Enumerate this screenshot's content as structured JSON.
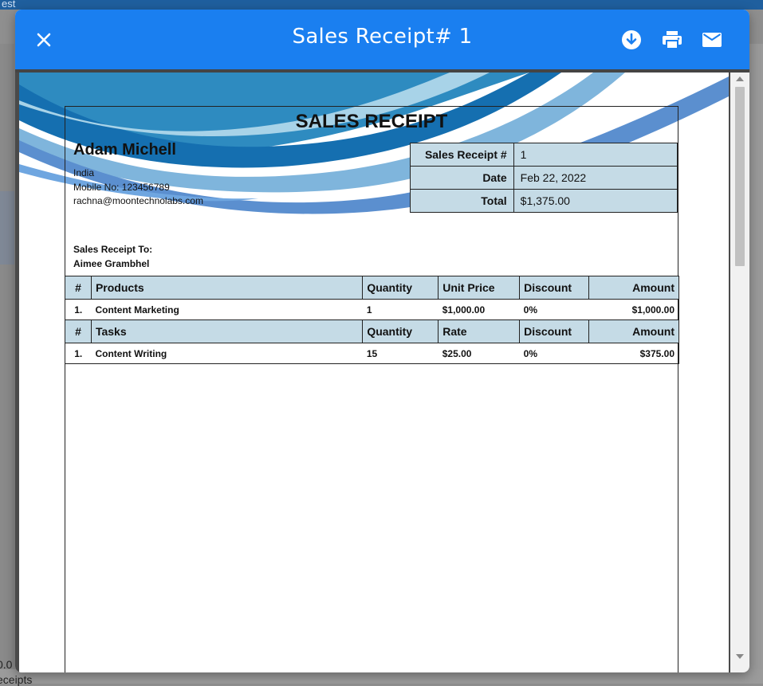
{
  "dialog": {
    "title": "Sales Receipt# 1"
  },
  "background": {
    "top_text": "est",
    "bottom_value": "0.0",
    "bottom_label": "eceipts"
  },
  "receipt": {
    "heading": "SALES RECEIPT",
    "company": {
      "name": "Adam Michell",
      "country": "India",
      "mobile": "Mobile No: 123456789",
      "email": "rachna@moontechnolabs.com"
    },
    "meta": [
      {
        "label": "Sales Receipt #",
        "value": "1"
      },
      {
        "label": "Date",
        "value": "Feb 22, 2022"
      },
      {
        "label": "Total",
        "value": "$1,375.00"
      }
    ],
    "bill_to_label": "Sales Receipt To:",
    "bill_to_name": "Aimee Grambhel",
    "products_header": {
      "num": "#",
      "name": "Products",
      "qty": "Quantity",
      "price": "Unit Price",
      "discount": "Discount",
      "amount": "Amount"
    },
    "products": [
      {
        "num": "1.",
        "name": "Content Marketing",
        "qty": "1",
        "price": "$1,000.00",
        "discount": "0%",
        "amount": "$1,000.00"
      }
    ],
    "tasks_header": {
      "num": "#",
      "name": "Tasks",
      "qty": "Quantity",
      "price": "Rate",
      "discount": "Discount",
      "amount": "Amount"
    },
    "tasks": [
      {
        "num": "1.",
        "name": "Content Writing",
        "qty": "15",
        "price": "$25.00",
        "discount": "0%",
        "amount": "$375.00"
      }
    ]
  },
  "colors": {
    "header_blue": "#1a7ff0",
    "table_header_bg": "#c5dbe6"
  },
  "icons": {
    "close": "close-icon",
    "download": "download-icon",
    "print": "print-icon",
    "mail": "mail-icon"
  }
}
